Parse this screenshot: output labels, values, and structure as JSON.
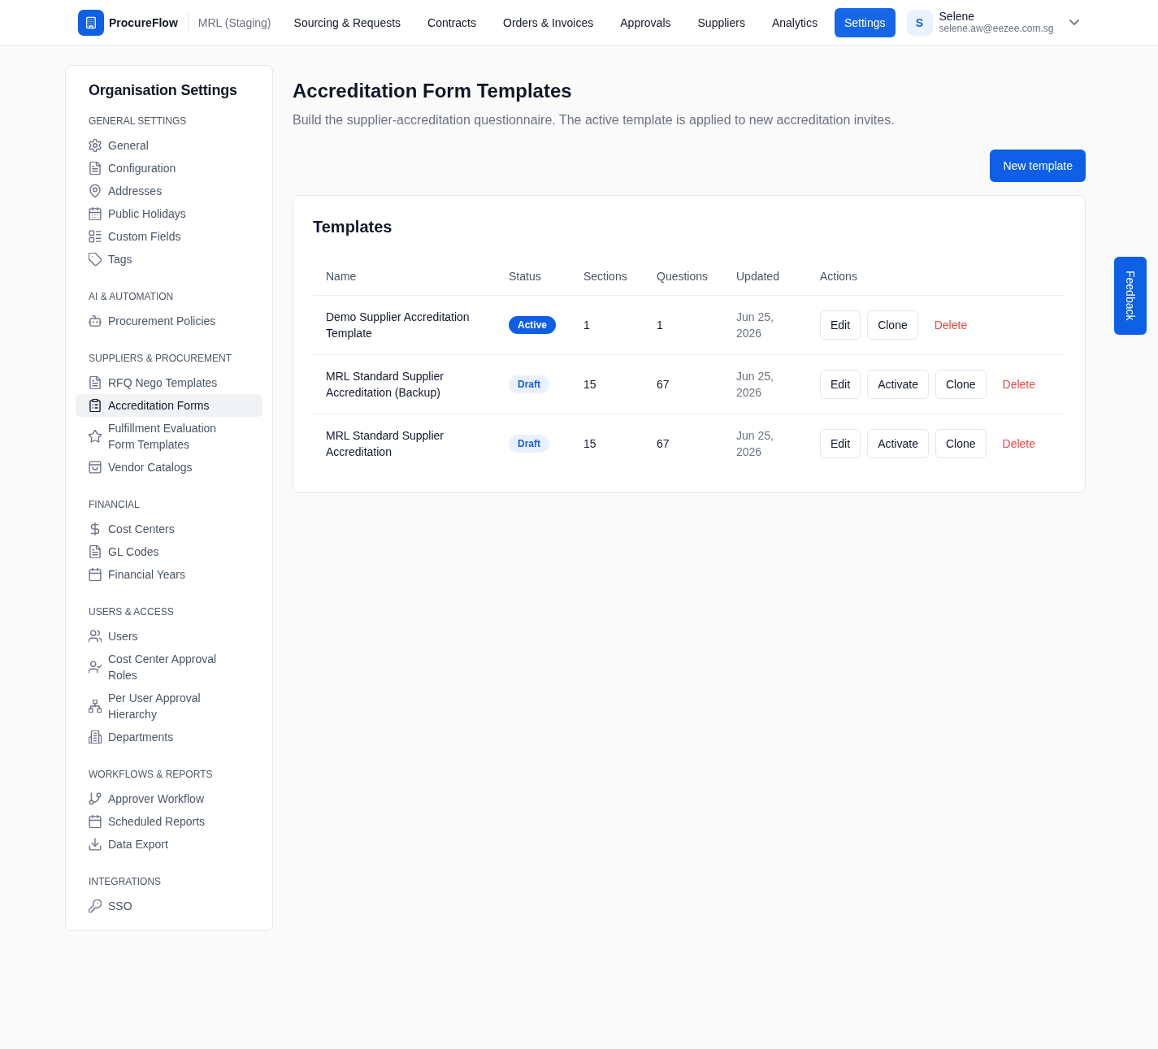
{
  "nav": {
    "brand": "ProcureFlow",
    "environment": "MRL (Staging)",
    "items": [
      {
        "label": "Sourcing & Requests",
        "selected": false
      },
      {
        "label": "Contracts",
        "selected": false
      },
      {
        "label": "Orders & Invoices",
        "selected": false
      },
      {
        "label": "Approvals",
        "selected": false
      },
      {
        "label": "Suppliers",
        "selected": false
      },
      {
        "label": "Analytics",
        "selected": false
      },
      {
        "label": "Settings",
        "selected": true
      }
    ],
    "user": {
      "initial": "S",
      "name": "Selene",
      "email": "selene.aw@eezee.com.sg"
    }
  },
  "sidebar": {
    "title": "Organisation Settings",
    "sections": [
      {
        "heading": "GENERAL SETTINGS",
        "items": [
          {
            "label": "General",
            "selected": false
          },
          {
            "label": "Configuration",
            "selected": false
          },
          {
            "label": "Addresses",
            "selected": false
          },
          {
            "label": "Public Holidays",
            "selected": false
          },
          {
            "label": "Custom Fields",
            "selected": false
          },
          {
            "label": "Tags",
            "selected": false
          }
        ]
      },
      {
        "heading": "AI & AUTOMATION",
        "items": [
          {
            "label": "Procurement Policies",
            "selected": false
          }
        ]
      },
      {
        "heading": "SUPPLIERS & PROCUREMENT",
        "items": [
          {
            "label": "RFQ Nego Templates",
            "selected": false
          },
          {
            "label": "Accreditation Forms",
            "selected": true
          },
          {
            "label": "Fulfillment Evaluation Form Templates",
            "selected": false
          },
          {
            "label": "Vendor Catalogs",
            "selected": false
          }
        ]
      },
      {
        "heading": "FINANCIAL",
        "items": [
          {
            "label": "Cost Centers",
            "selected": false
          },
          {
            "label": "GL Codes",
            "selected": false
          },
          {
            "label": "Financial Years",
            "selected": false
          }
        ]
      },
      {
        "heading": "USERS & ACCESS",
        "items": [
          {
            "label": "Users",
            "selected": false
          },
          {
            "label": "Cost Center Approval Roles",
            "selected": false
          },
          {
            "label": "Per User Approval Hierarchy",
            "selected": false
          },
          {
            "label": "Departments",
            "selected": false
          }
        ]
      },
      {
        "heading": "WORKFLOWS & REPORTS",
        "items": [
          {
            "label": "Approver Workflow",
            "selected": false
          },
          {
            "label": "Scheduled Reports",
            "selected": false
          },
          {
            "label": "Data Export",
            "selected": false
          }
        ]
      },
      {
        "heading": "INTEGRATIONS",
        "items": [
          {
            "label": "SSO",
            "selected": false
          }
        ]
      }
    ]
  },
  "page": {
    "title": "Accreditation Form Templates",
    "description": "Build the supplier-accreditation questionnaire. The active template is applied to new accreditation invites.",
    "primary_button": "New template"
  },
  "templates_card": {
    "title": "Templates",
    "columns": [
      "Name",
      "Status",
      "Sections",
      "Questions",
      "Updated",
      "Actions"
    ],
    "rows": [
      {
        "name": "Demo Supplier Accreditation Template",
        "status": {
          "label": "Active",
          "kind": "active"
        },
        "sections": "1",
        "questions": "1",
        "updated": "Jun 25, 2026",
        "actions": [
          {
            "label": "Edit",
            "kind": "outline"
          },
          {
            "label": "Clone",
            "kind": "outline"
          },
          {
            "label": "Delete",
            "kind": "danger"
          }
        ]
      },
      {
        "name": "MRL Standard Supplier Accreditation (Backup)",
        "status": {
          "label": "Draft",
          "kind": "draft"
        },
        "sections": "15",
        "questions": "67",
        "updated": "Jun 25, 2026",
        "actions": [
          {
            "label": "Edit",
            "kind": "outline"
          },
          {
            "label": "Activate",
            "kind": "outline"
          },
          {
            "label": "Clone",
            "kind": "outline"
          },
          {
            "label": "Delete",
            "kind": "danger"
          }
        ]
      },
      {
        "name": "MRL Standard Supplier Accreditation",
        "status": {
          "label": "Draft",
          "kind": "draft"
        },
        "sections": "15",
        "questions": "67",
        "updated": "Jun 25, 2026",
        "actions": [
          {
            "label": "Edit",
            "kind": "outline"
          },
          {
            "label": "Activate",
            "kind": "outline"
          },
          {
            "label": "Clone",
            "kind": "outline"
          },
          {
            "label": "Delete",
            "kind": "danger"
          }
        ]
      }
    ]
  },
  "feedback_tab": {
    "label": "Feedback"
  }
}
